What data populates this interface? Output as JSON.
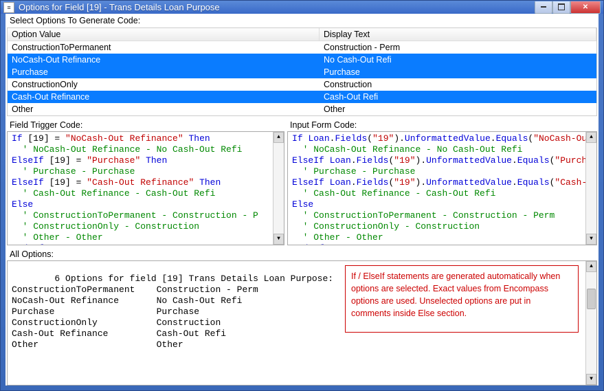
{
  "window": {
    "title": "Options for Field [19] - Trans Details Loan Purpose"
  },
  "selectOptionsLabel": "Select Options To Generate Code:",
  "columns": {
    "optionValue": "Option Value",
    "displayText": "Display Text"
  },
  "options": [
    {
      "value": "ConstructionToPermanent",
      "display": "Construction - Perm",
      "selected": false
    },
    {
      "value": "NoCash-Out Refinance",
      "display": "No Cash-Out Refi",
      "selected": true
    },
    {
      "value": "Purchase",
      "display": "Purchase",
      "selected": true
    },
    {
      "value": "ConstructionOnly",
      "display": "Construction",
      "selected": false
    },
    {
      "value": "Cash-Out Refinance",
      "display": "Cash-Out Refi",
      "selected": true
    },
    {
      "value": "Other",
      "display": "Other",
      "selected": false
    }
  ],
  "triggerLabel": "Field Trigger Code:",
  "inputFormLabel": "Input Form Code:",
  "triggerCode": {
    "lines": [
      {
        "t": "If [19] = \"NoCash-Out Refinance\" Then",
        "kw": [
          "If",
          "Then"
        ],
        "str": "\"NoCash-Out Refinance\""
      },
      {
        "t": "  ' NoCash-Out Refinance - No Cash-Out Refi",
        "cm": true
      },
      {
        "t": "ElseIf [19] = \"Purchase\" Then",
        "kw": [
          "ElseIf",
          "Then"
        ],
        "str": "\"Purchase\""
      },
      {
        "t": "  ' Purchase - Purchase",
        "cm": true
      },
      {
        "t": "ElseIf [19] = \"Cash-Out Refinance\" Then",
        "kw": [
          "ElseIf",
          "Then"
        ],
        "str": "\"Cash-Out Refinance\""
      },
      {
        "t": "  ' Cash-Out Refinance - Cash-Out Refi",
        "cm": true
      },
      {
        "t": "Else",
        "kw": [
          "Else"
        ]
      },
      {
        "t": "  ' ConstructionToPermanent - Construction - P",
        "cm": true
      },
      {
        "t": "  ' ConstructionOnly - Construction",
        "cm": true
      },
      {
        "t": "  ' Other - Other",
        "cm": true
      },
      {
        "t": "End If",
        "kw": [
          "End",
          "If"
        ]
      }
    ]
  },
  "inputFormCode": {
    "lines": [
      {
        "t": "If Loan.Fields(\"19\").UnformattedValue.Equals(\"NoCash-Ou",
        "kw": [
          "If"
        ],
        "str": "\"NoCash-Ou",
        "meth": [
          "Loan",
          "Fields",
          "UnformattedValue",
          "Equals"
        ],
        "arg": "\"19\""
      },
      {
        "t": "  ' NoCash-Out Refinance - No Cash-Out Refi",
        "cm": true
      },
      {
        "t": "ElseIf Loan.Fields(\"19\").UnformattedValue.Equals(\"Purcha",
        "kw": [
          "ElseIf"
        ],
        "str": "\"Purcha",
        "meth": [
          "Loan",
          "Fields",
          "UnformattedValue",
          "Equals"
        ],
        "arg": "\"19\""
      },
      {
        "t": "  ' Purchase - Purchase",
        "cm": true
      },
      {
        "t": "ElseIf Loan.Fields(\"19\").UnformattedValue.Equals(\"Cash-O",
        "kw": [
          "ElseIf"
        ],
        "str": "\"Cash-O",
        "meth": [
          "Loan",
          "Fields",
          "UnformattedValue",
          "Equals"
        ],
        "arg": "\"19\""
      },
      {
        "t": "  ' Cash-Out Refinance - Cash-Out Refi",
        "cm": true
      },
      {
        "t": "Else",
        "kw": [
          "Else"
        ]
      },
      {
        "t": "  ' ConstructionToPermanent - Construction - Perm",
        "cm": true
      },
      {
        "t": "  ' ConstructionOnly - Construction",
        "cm": true
      },
      {
        "t": "  ' Other - Other",
        "cm": true
      },
      {
        "t": "End If",
        "kw": [
          "End",
          "If"
        ]
      }
    ]
  },
  "allOptionsLabel": "All Options:",
  "allOptionsText": "6 Options for field [19] Trans Details Loan Purpose:\nConstructionToPermanent    Construction - Perm\nNoCash-Out Refinance       No Cash-Out Refi\nPurchase                   Purchase\nConstructionOnly           Construction\nCash-Out Refinance         Cash-Out Refi\nOther                      Other",
  "noteText": "If / ElseIf statements are generated automatically when options are selected. Exact values from Encompass options are used.  Unselected options are put in comments inside Else section."
}
